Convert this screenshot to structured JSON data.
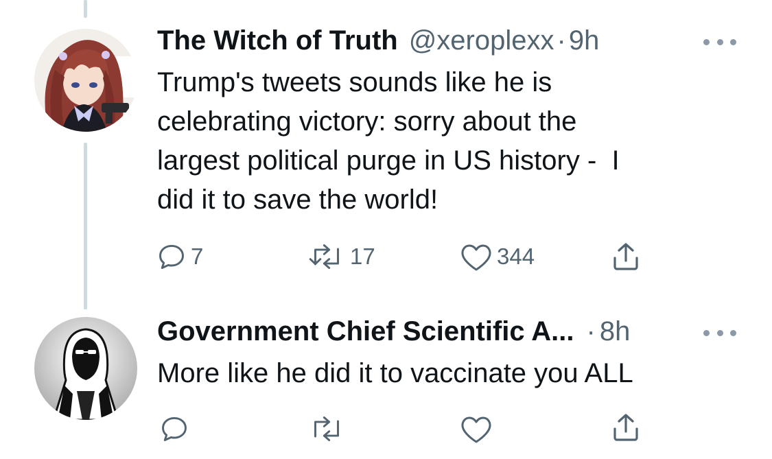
{
  "tweets": [
    {
      "name": "The Witch of Truth",
      "handle": "@xeroplexx",
      "separator": "·",
      "time": "9h",
      "text": "Trump's tweets sounds like he is\ncelebrating victory: sorry about the\nlargest political purge in US history -  I\ndid it to save the world!",
      "replies": "7",
      "retweets": "17",
      "likes": "344",
      "avatar_icon": "anime-girl-avatar"
    },
    {
      "name": "Government Chief Scientific A...",
      "separator": "·",
      "time": "8h",
      "text": "More like he did it to vaccinate you ALL",
      "avatar_icon": "hooded-figure-avatar"
    }
  ],
  "colors": {
    "text": "#0f1419",
    "secondary": "#536471",
    "thread_line": "#cfd9de",
    "icon": "#536471"
  }
}
